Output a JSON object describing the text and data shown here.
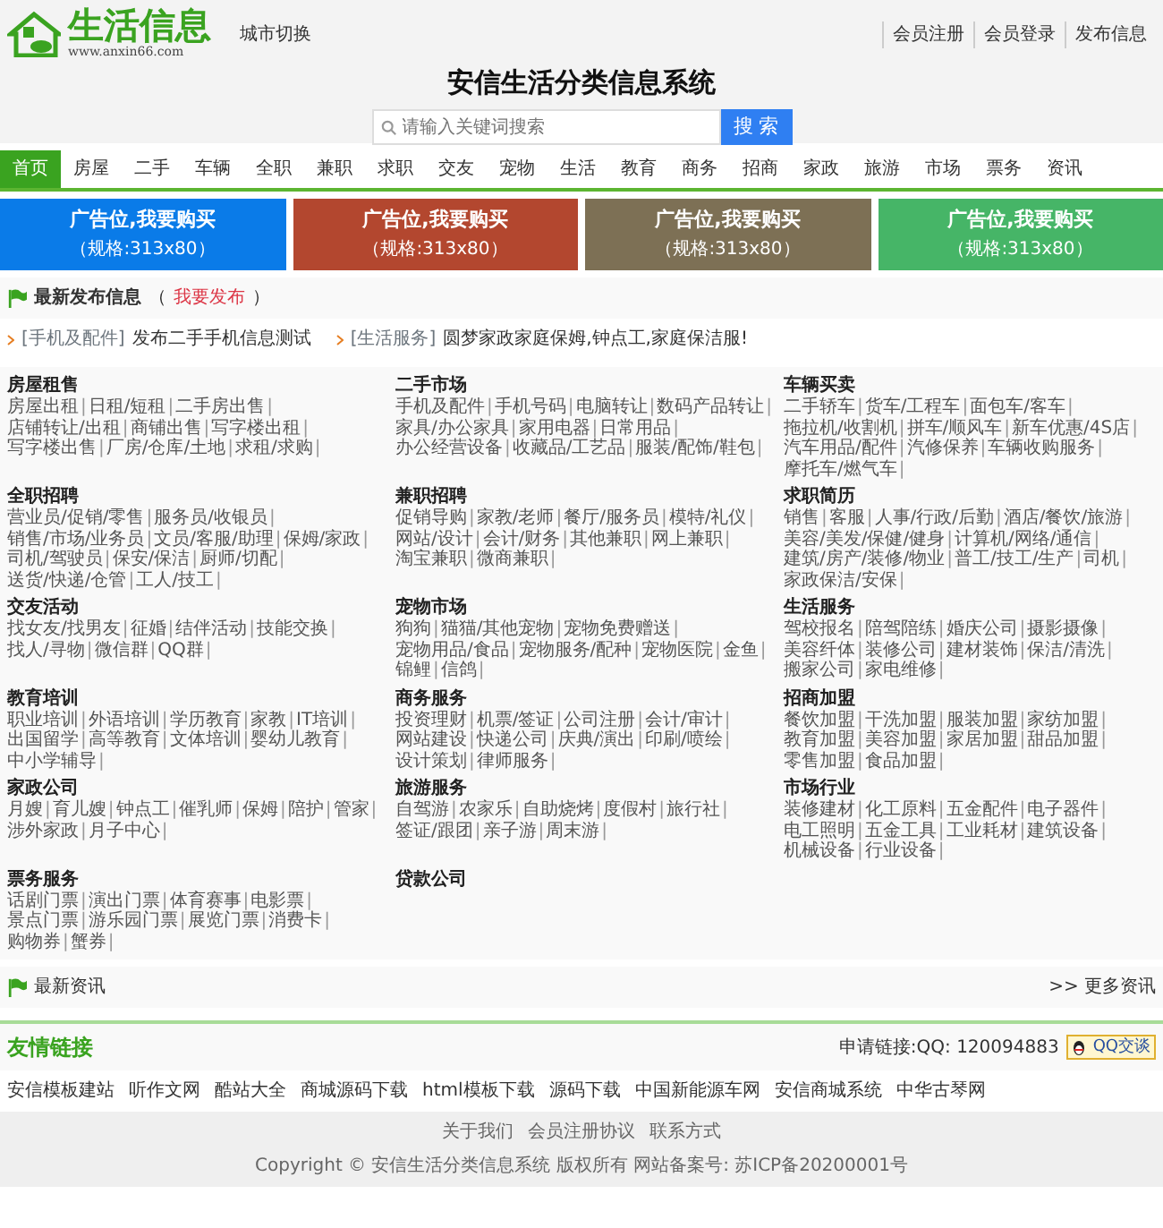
{
  "header": {
    "logo_text": "生活信息",
    "logo_url": "www.anxin66.com",
    "city_switch": "城市切换",
    "top_links": [
      "会员注册",
      "会员登录",
      "发布信息"
    ]
  },
  "site_title": "安信生活分类信息系统",
  "search": {
    "placeholder": "请输入关键词搜索",
    "button": "搜 索"
  },
  "nav": [
    {
      "label": "首页",
      "selected": true
    },
    {
      "label": "房屋",
      "selected": false
    },
    {
      "label": "二手",
      "selected": false
    },
    {
      "label": "车辆",
      "selected": false
    },
    {
      "label": "全职",
      "selected": false
    },
    {
      "label": "兼职",
      "selected": false
    },
    {
      "label": "求职",
      "selected": false
    },
    {
      "label": "交友",
      "selected": false
    },
    {
      "label": "宠物",
      "selected": false
    },
    {
      "label": "生活",
      "selected": false
    },
    {
      "label": "教育",
      "selected": false
    },
    {
      "label": "商务",
      "selected": false
    },
    {
      "label": "招商",
      "selected": false
    },
    {
      "label": "家政",
      "selected": false
    },
    {
      "label": "旅游",
      "selected": false
    },
    {
      "label": "市场",
      "selected": false
    },
    {
      "label": "票务",
      "selected": false
    },
    {
      "label": "资讯",
      "selected": false
    }
  ],
  "ads": [
    {
      "title": "广告位,我要购买",
      "spec": "（规格:313x80）",
      "color": "#0a7be8"
    },
    {
      "title": "广告位,我要购买",
      "spec": "（规格:313x80）",
      "color": "#b3472f"
    },
    {
      "title": "广告位,我要购买",
      "spec": "（规格:313x80）",
      "color": "#7d7055"
    },
    {
      "title": "广告位,我要购买",
      "spec": "（规格:313x80）",
      "color": "#46b567"
    }
  ],
  "latest": {
    "title": "最新发布信息",
    "bracket_open": "（",
    "publish_link": "我要发布",
    "bracket_close": "）",
    "posts": [
      {
        "category": "[手机及配件]",
        "title": "发布二手手机信息测试"
      },
      {
        "category": "[生活服务]",
        "title": "圆梦家政家庭保姆,钟点工,家庭保洁服!"
      }
    ]
  },
  "categories": {
    "separator": "|",
    "groups": [
      {
        "title": "房屋租售",
        "items": [
          "房屋出租",
          "日租/短租",
          "二手房出售",
          "店铺转让/出租",
          "商铺出售",
          "写字楼出租",
          "写字楼出售",
          "厂房/仓库/土地",
          "求租/求购"
        ]
      },
      {
        "title": "二手市场",
        "items": [
          "手机及配件",
          "手机号码",
          "电脑转让",
          "数码产品转让",
          "家具/办公家具",
          "家用电器",
          "日常用品",
          "办公经营设备",
          "收藏品/工艺品",
          "服装/配饰/鞋包"
        ]
      },
      {
        "title": "车辆买卖",
        "items": [
          "二手轿车",
          "货车/工程车",
          "面包车/客车",
          "拖拉机/收割机",
          "拼车/顺风车",
          "新车优惠/4S店",
          "汽车用品/配件",
          "汽修保养",
          "车辆收购服务",
          "摩托车/燃气车"
        ]
      },
      {
        "title": "全职招聘",
        "items": [
          "营业员/促销/零售",
          "服务员/收银员",
          "销售/市场/业务员",
          "文员/客服/助理",
          "保姆/家政",
          "司机/驾驶员",
          "保安/保洁",
          "厨师/切配",
          "送货/快递/仓管",
          "工人/技工"
        ]
      },
      {
        "title": "兼职招聘",
        "items": [
          "促销导购",
          "家教/老师",
          "餐厅/服务员",
          "模特/礼仪",
          "网站/设计",
          "会计/财务",
          "其他兼职",
          "网上兼职",
          "淘宝兼职",
          "微商兼职"
        ]
      },
      {
        "title": "求职简历",
        "items": [
          "销售",
          "客服",
          "人事/行政/后勤",
          "酒店/餐饮/旅游",
          "美容/美发/保健/健身",
          "计算机/网络/通信",
          "建筑/房产/装修/物业",
          "普工/技工/生产",
          "司机",
          "家政保洁/安保"
        ]
      },
      {
        "title": "交友活动",
        "items": [
          "找女友/找男友",
          "征婚",
          "结伴活动",
          "技能交换",
          "找人/寻物",
          "微信群",
          "QQ群"
        ]
      },
      {
        "title": "宠物市场",
        "items": [
          "狗狗",
          "猫猫/其他宠物",
          "宠物免费赠送",
          "宠物用品/食品",
          "宠物服务/配种",
          "宠物医院",
          "金鱼",
          "锦鲤",
          "信鸽"
        ]
      },
      {
        "title": "生活服务",
        "items": [
          "驾校报名",
          "陪驾陪练",
          "婚庆公司",
          "摄影摄像",
          "美容纤体",
          "装修公司",
          "建材装饰",
          "保洁/清洗",
          "搬家公司",
          "家电维修"
        ]
      },
      {
        "title": "教育培训",
        "items": [
          "职业培训",
          "外语培训",
          "学历教育",
          "家教",
          "IT培训",
          "出国留学",
          "高等教育",
          "文体培训",
          "婴幼儿教育",
          "中小学辅导"
        ]
      },
      {
        "title": "商务服务",
        "items": [
          "投资理财",
          "机票/签证",
          "公司注册",
          "会计/审计",
          "网站建设",
          "快递公司",
          "庆典/演出",
          "印刷/喷绘",
          "设计策划",
          "律师服务"
        ]
      },
      {
        "title": "招商加盟",
        "items": [
          "餐饮加盟",
          "干洗加盟",
          "服装加盟",
          "家纺加盟",
          "教育加盟",
          "美容加盟",
          "家居加盟",
          "甜品加盟",
          "零售加盟",
          "食品加盟"
        ]
      },
      {
        "title": "家政公司",
        "items": [
          "月嫂",
          "育儿嫂",
          "钟点工",
          "催乳师",
          "保姆",
          "陪护",
          "管家",
          "涉外家政",
          "月子中心"
        ]
      },
      {
        "title": "旅游服务",
        "items": [
          "自驾游",
          "农家乐",
          "自助烧烤",
          "度假村",
          "旅行社",
          "签证/跟团",
          "亲子游",
          "周末游"
        ]
      },
      {
        "title": "市场行业",
        "items": [
          "装修建材",
          "化工原料",
          "五金配件",
          "电子器件",
          "电工照明",
          "五金工具",
          "工业耗材",
          "建筑设备",
          "机械设备",
          "行业设备"
        ]
      },
      {
        "title": "票务服务",
        "items": [
          "话剧门票",
          "演出门票",
          "体育赛事",
          "电影票",
          "景点门票",
          "游乐园门票",
          "展览门票",
          "消费卡",
          "购物券",
          "蟹券"
        ]
      },
      {
        "title": "贷款公司"
      }
    ]
  },
  "news": {
    "title": "最新资讯",
    "more": ">> 更多资讯"
  },
  "friend_links": {
    "title": "友情链接",
    "apply": "申请链接:QQ: 120094883",
    "qq_button": "QQ交谈",
    "links": [
      "安信模板建站",
      "听作文网",
      "酷站大全",
      "商城源码下载",
      "html模板下载",
      "源码下载",
      "中国新能源车网",
      "安信商城系统",
      "中华古琴网"
    ]
  },
  "footer": {
    "links": [
      "关于我们",
      "会员注册协议",
      "联系方式"
    ],
    "copyright": "Copyright © 安信生活分类信息系统 版权所有 网站备案号: 苏ICP备20200001号"
  }
}
